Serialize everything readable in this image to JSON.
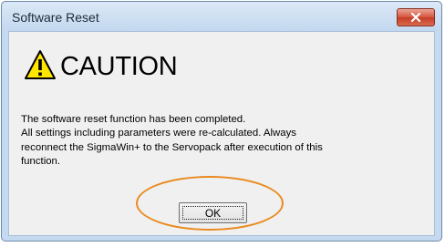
{
  "window": {
    "title": "Software Reset",
    "close_icon": "close-x-icon"
  },
  "dialog": {
    "icon": "warning-triangle-icon",
    "heading": "CAUTION",
    "message_lines": [
      "The software reset function has been completed.",
      "All settings including parameters were re-calculated. Always",
      "reconnect the SigmaWin+ to the Servopack after execution of this",
      "function."
    ],
    "ok_label": "OK"
  },
  "colors": {
    "title_bar": "#c5daf0",
    "close_button": "#d6553e",
    "dialog_background": "#f0f0f0",
    "warning_fill": "#ffe600",
    "highlight_ring": "#ea8a1e"
  }
}
